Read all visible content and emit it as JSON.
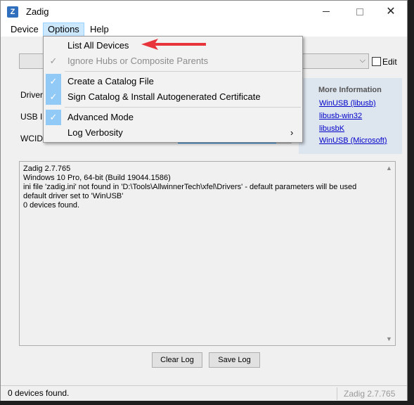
{
  "window": {
    "title": "Zadig",
    "icon_letter": "Z"
  },
  "menubar": {
    "device": "Device",
    "options": "Options",
    "help": "Help"
  },
  "options_menu": {
    "items": [
      {
        "label": "List All Devices",
        "checked": false,
        "disabled": false
      },
      {
        "label": "Ignore Hubs or Composite Parents",
        "checked": true,
        "disabled": true
      },
      {
        "label": "Create a Catalog File",
        "checked": true,
        "disabled": false
      },
      {
        "label": "Sign Catalog & Install Autogenerated Certificate",
        "checked": true,
        "disabled": false
      },
      {
        "label": "Advanced Mode",
        "checked": true,
        "disabled": false
      },
      {
        "label": "Log Verbosity",
        "submenu": true
      }
    ],
    "submenu_arrow": "›"
  },
  "form": {
    "edit_label": "Edit",
    "driver_label": "Driver",
    "usb_id_label": "USB ID",
    "wcid_label": "WCID"
  },
  "more_info": {
    "title": "More Information",
    "links": [
      "WinUSB (libusb)",
      "libusb-win32",
      "libusbK",
      "WinUSB (Microsoft)"
    ]
  },
  "log": {
    "lines": [
      "Zadig 2.7.765",
      "Windows 10 Pro, 64-bit (Build 19044.1586)",
      "ini file 'zadig.ini' not found in 'D:\\Tools\\AllwinnerTech\\xfel\\Drivers' - default parameters will be used",
      "default driver set to 'WinUSB'",
      "0 devices found."
    ]
  },
  "buttons": {
    "clear_log": "Clear Log",
    "save_log": "Save Log"
  },
  "statusbar": {
    "left": "0 devices found.",
    "right": "Zadig 2.7.765"
  },
  "colors": {
    "accent": "#0078d7",
    "menu_highlight": "#91c9f7",
    "annotation_arrow": "#e8353b",
    "link": "#0000c8"
  }
}
